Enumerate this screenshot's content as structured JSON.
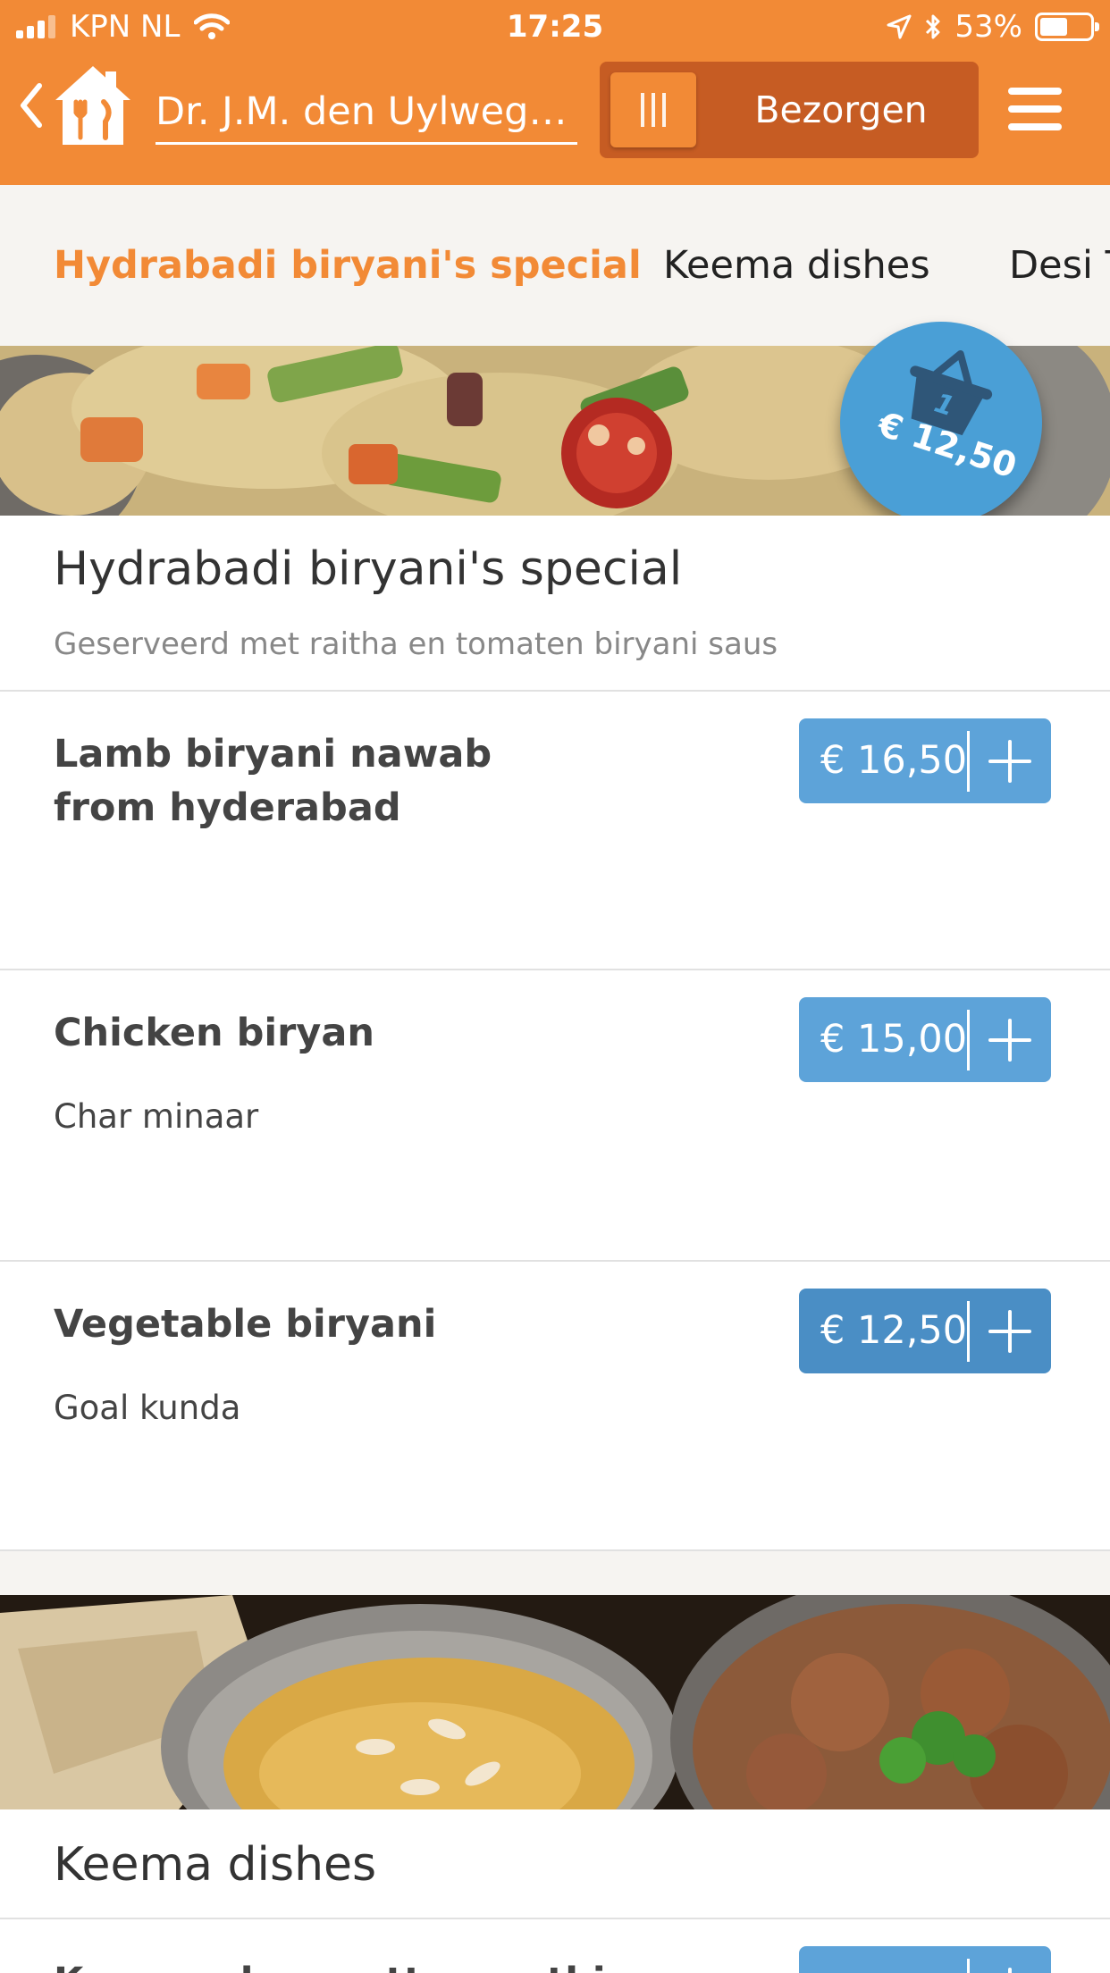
{
  "status_bar": {
    "carrier": "KPN NL",
    "time": "17:25",
    "battery": "53%"
  },
  "nav": {
    "address": "Dr. J.M. den Uylweg,...",
    "mode": "Bezorgen"
  },
  "tabs": [
    {
      "label": "Hydrabadi biryani's special"
    },
    {
      "label": "Keema dishes"
    },
    {
      "label": "Desi T"
    }
  ],
  "cart": {
    "count": "1",
    "total": "€ 12,50"
  },
  "sections": [
    {
      "title": "Hydrabadi biryani's special",
      "subtitle": "Geserveerd met raitha en tomaten biryani saus",
      "items": [
        {
          "name": "Lamb biryani nawab from hyderabad",
          "description": "",
          "price": "€ 16,50"
        },
        {
          "name": "Chicken biryan",
          "description": "Char minaar",
          "price": "€ 15,00"
        },
        {
          "name": "Vegetable biryani",
          "description": "Goal kunda",
          "price": "€ 12,50"
        }
      ]
    },
    {
      "title": "Keema dishes",
      "items": [
        {
          "name": "Keema aloo matter methi",
          "price": ""
        }
      ]
    }
  ],
  "colors": {
    "brand_orange": "#F28A36",
    "toggle_dark": "#C65C23",
    "price_blue": "#5DA3D9",
    "cart_blue": "#4A9FD6"
  }
}
